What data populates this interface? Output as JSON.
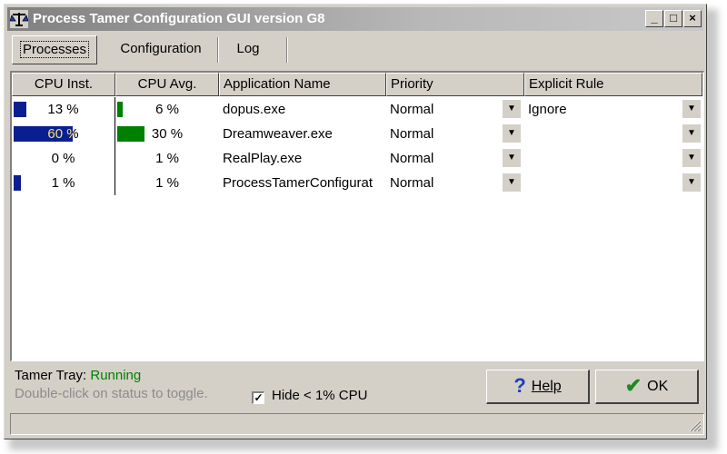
{
  "window": {
    "title": "Process Tamer Configuration GUI version G8",
    "minimize_glyph": "_",
    "maximize_glyph": "□",
    "close_glyph": "×"
  },
  "tabs": [
    {
      "label": "Processes",
      "active": true
    },
    {
      "label": "Configuration",
      "active": false
    },
    {
      "label": "Log",
      "active": false
    }
  ],
  "table": {
    "columns": [
      "CPU Inst.",
      "CPU Avg.",
      "Application Name",
      "Priority",
      "Explicit Rule"
    ],
    "rows": [
      {
        "cpu_inst": "13 %",
        "cpu_inst_value": 13,
        "cpu_avg": "6 %",
        "cpu_avg_value": 6,
        "app": "dopus.exe",
        "priority": "Normal",
        "rule": "Ignore"
      },
      {
        "cpu_inst": "60 %",
        "cpu_inst_value": 60,
        "cpu_avg": "30 %",
        "cpu_avg_value": 30,
        "app": "Dreamweaver.exe",
        "priority": "Normal",
        "rule": ""
      },
      {
        "cpu_inst": "0 %",
        "cpu_inst_value": 0,
        "cpu_avg": "1 %",
        "cpu_avg_value": 1,
        "app": "RealPlay.exe",
        "priority": "Normal",
        "rule": ""
      },
      {
        "cpu_inst": "1 %",
        "cpu_inst_value": 1,
        "cpu_avg": "1 %",
        "cpu_avg_value": 1,
        "app": "ProcessTamerConfigurat",
        "priority": "Normal",
        "rule": ""
      }
    ]
  },
  "status": {
    "tray_label": "Tamer Tray:",
    "tray_state": "Running",
    "hint": "Double-click on status to toggle."
  },
  "options": {
    "hide_label": "Hide < 1% CPU",
    "hide_checked": true
  },
  "buttons": {
    "help_label": "Help",
    "ok_label": "OK"
  },
  "colors": {
    "inst_bar": "#0a1f8f",
    "avg_bar": "#008000",
    "running": "#008000",
    "help_icon": "#1a3fbf",
    "ok_icon": "#1e8a1e"
  },
  "icons": {
    "app": "scales-icon",
    "dropdown": "triangle-down",
    "help": "question-mark",
    "ok": "check-mark",
    "grip": "resize-grip"
  }
}
